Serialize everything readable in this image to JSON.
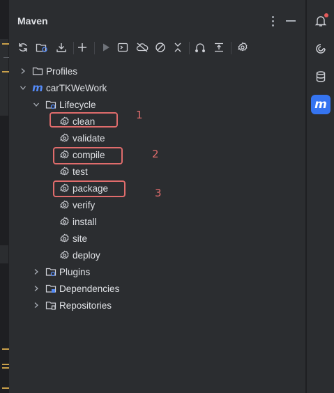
{
  "window": {
    "title": "Maven"
  },
  "toolbar": {
    "icons": [
      "reload-icon",
      "reimport-icon",
      "download-icon",
      "add-icon",
      "run-icon",
      "run-configuration-icon",
      "offline-icon",
      "skip-tests-icon",
      "collapse-all-icon",
      "analyze-dependencies-icon",
      "show-dependencies-icon",
      "settings-icon"
    ]
  },
  "tree": {
    "profiles": "Profiles",
    "project": "carTKWeWork",
    "lifecycle": "Lifecycle",
    "goals": [
      "clean",
      "validate",
      "compile",
      "test",
      "package",
      "verify",
      "install",
      "site",
      "deploy"
    ],
    "plugins": "Plugins",
    "dependencies": "Dependencies",
    "repositories": "Repositories"
  },
  "annotations": {
    "n1": "1",
    "n2": "2",
    "n3": "3"
  },
  "colors": {
    "highlight": "#e06c6c",
    "accent": "#3574f0",
    "background": "#2b2d30"
  },
  "stripe": {
    "icons": [
      "notifications-icon",
      "ai-assistant-icon",
      "database-icon",
      "maven-icon"
    ]
  }
}
